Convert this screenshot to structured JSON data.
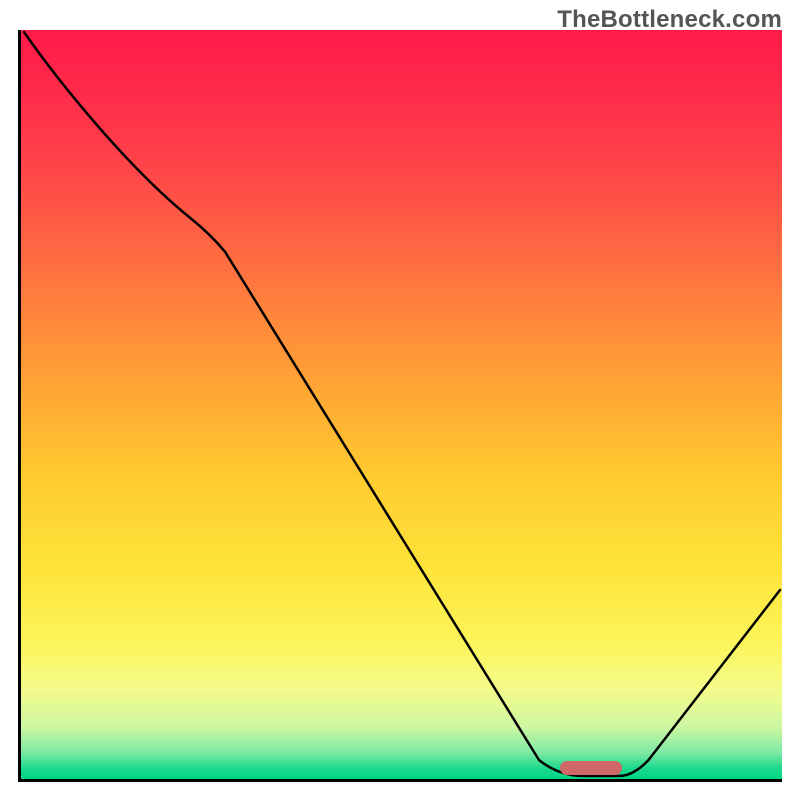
{
  "brand": {
    "watermark": "TheBottleneck.com"
  },
  "chart_data": {
    "type": "line",
    "title": "",
    "xlabel": "",
    "ylabel": "",
    "xlim": [
      0,
      100
    ],
    "ylim": [
      0,
      100
    ],
    "x": [
      0,
      8,
      18,
      24,
      70,
      74,
      79,
      100
    ],
    "values": [
      100,
      92,
      79,
      74,
      1,
      0,
      0,
      25
    ],
    "annotations": [
      {
        "kind": "optimal-range",
        "x_start": 71,
        "x_end": 79,
        "y": 1
      }
    ],
    "background_gradient": [
      {
        "stop": 0,
        "color": "#ff1a4a"
      },
      {
        "stop": 50,
        "color": "#ffa634"
      },
      {
        "stop": 80,
        "color": "#fbf55b"
      },
      {
        "stop": 100,
        "color": "#00d684"
      }
    ]
  }
}
